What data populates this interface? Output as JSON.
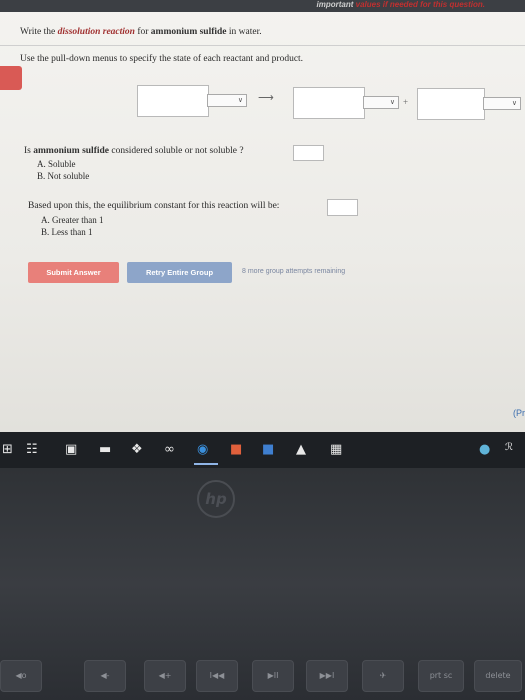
{
  "header": {
    "hint_text": "values if needed for this question.",
    "hint_prefix": "important"
  },
  "question": {
    "intro": "Write the",
    "emphasis": "dissolution reaction",
    "mid": "for",
    "compound": "ammonium sulfide",
    "tail": "in water.",
    "instructions": "Use the pull-down menus to specify the state of each reactant and product."
  },
  "equation": {
    "arrow": "⟶",
    "plus": "+",
    "chevron": "∨"
  },
  "soluble_q": {
    "prefix": "Is",
    "compound": "ammonium sulfide",
    "suffix": "considered soluble or not soluble ?",
    "options": [
      "A. Soluble",
      "B. Not soluble"
    ]
  },
  "equilibrium_q": {
    "text": "Based upon this, the equilibrium constant for this reaction will be:",
    "options": [
      "A. Greater than 1",
      "B. Less than 1"
    ]
  },
  "buttons": {
    "submit": "Submit Answer",
    "retry": "Retry Entire Group",
    "attempts": "8 more group attempts remaining"
  },
  "nav": {
    "edge_label": "(Pr"
  },
  "taskbar_icons": [
    "windows-icon",
    "task-view-icon",
    "store-icon",
    "file-explorer-icon",
    "dropbox-icon",
    "link-icon",
    "edge-icon",
    "powerpoint-icon",
    "word-icon",
    "photos-icon",
    "calculator-icon",
    "chrome-icon",
    "people-icon"
  ],
  "keyboard": {
    "keys": [
      "f1",
      "f2",
      "f3",
      "f4",
      "f5",
      "f6",
      "f7",
      "f8",
      "f9",
      "prt sc",
      "delete"
    ],
    "labels": [
      "◀o",
      "◀-",
      "◀+",
      "I◀◀",
      "▶II",
      "▶▶I",
      "✈",
      "prt sc",
      "delete"
    ]
  }
}
